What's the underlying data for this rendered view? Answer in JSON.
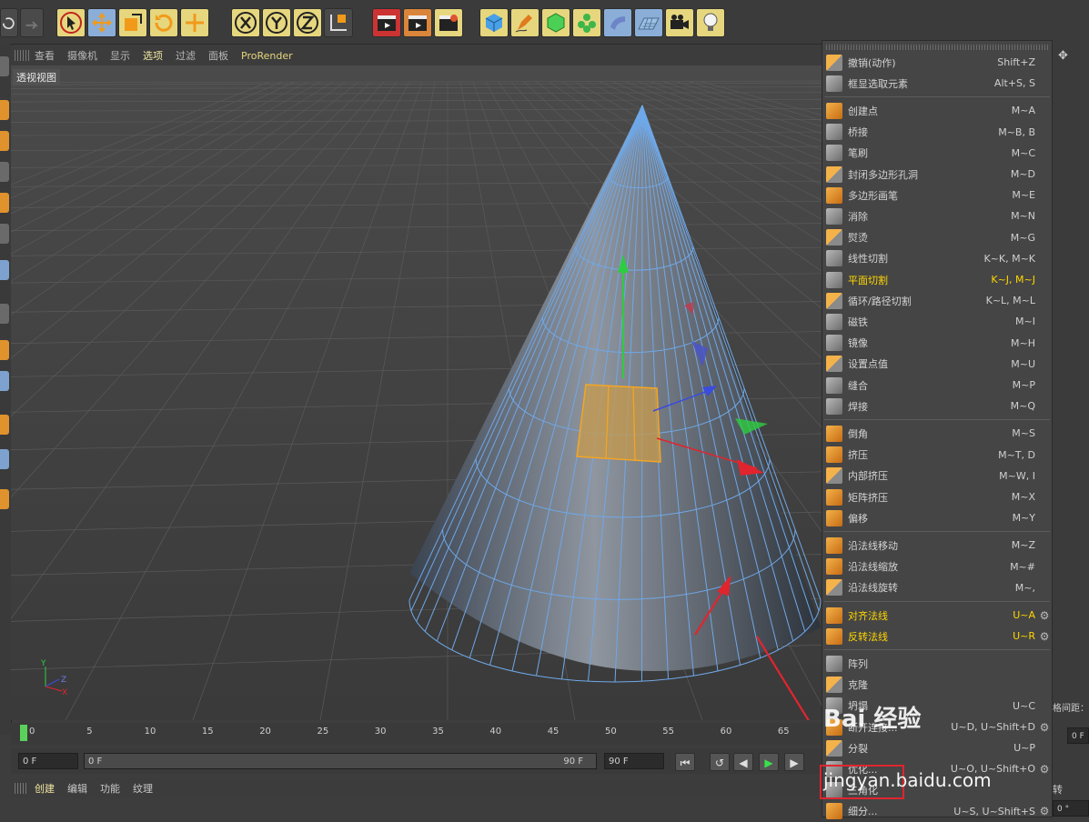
{
  "viewport": {
    "menu": [
      "查看",
      "摄像机",
      "显示",
      "选项",
      "过滤",
      "面板",
      "ProRender"
    ],
    "active_menu": "选项",
    "title": "透视视图",
    "axis_labels": {
      "y": "Y",
      "z": "Z",
      "x": "X"
    }
  },
  "context_menu": {
    "items": [
      {
        "label": "撤销(动作)",
        "shortcut": "Shift+Z",
        "icon": "undo-icon"
      },
      {
        "label": "框显选取元素",
        "shortcut": "Alt+S, S",
        "icon": "frame-selection-icon"
      },
      {
        "sep": true
      },
      {
        "label": "创建点",
        "shortcut": "M~A",
        "icon": "create-point-icon"
      },
      {
        "label": "桥接",
        "shortcut": "M~B, B",
        "icon": "bridge-icon"
      },
      {
        "label": "笔刷",
        "shortcut": "M~C",
        "icon": "brush-icon"
      },
      {
        "label": "封闭多边形孔洞",
        "shortcut": "M~D",
        "icon": "close-hole-icon"
      },
      {
        "label": "多边形画笔",
        "shortcut": "M~E",
        "icon": "polygon-pen-icon"
      },
      {
        "label": "消除",
        "shortcut": "M~N",
        "icon": "dissolve-icon"
      },
      {
        "label": "熨烫",
        "shortcut": "M~G",
        "icon": "iron-icon"
      },
      {
        "label": "线性切割",
        "shortcut": "K~K, M~K",
        "icon": "line-cut-icon"
      },
      {
        "label": "平面切割",
        "shortcut": "K~J, M~J",
        "icon": "plane-cut-icon",
        "highlight": true
      },
      {
        "label": "循环/路径切割",
        "shortcut": "K~L, M~L",
        "icon": "loop-cut-icon"
      },
      {
        "label": "磁铁",
        "shortcut": "M~I",
        "icon": "magnet-icon"
      },
      {
        "label": "镜像",
        "shortcut": "M~H",
        "icon": "mirror-icon"
      },
      {
        "label": "设置点值",
        "shortcut": "M~U",
        "icon": "set-point-value-icon"
      },
      {
        "label": "缝合",
        "shortcut": "M~P",
        "icon": "stitch-icon"
      },
      {
        "label": "焊接",
        "shortcut": "M~Q",
        "icon": "weld-icon"
      },
      {
        "sep": true
      },
      {
        "label": "倒角",
        "shortcut": "M~S",
        "icon": "bevel-icon"
      },
      {
        "label": "挤压",
        "shortcut": "M~T, D",
        "icon": "extrude-icon"
      },
      {
        "label": "内部挤压",
        "shortcut": "M~W, I",
        "icon": "extrude-inner-icon"
      },
      {
        "label": "矩阵挤压",
        "shortcut": "M~X",
        "icon": "matrix-extrude-icon"
      },
      {
        "label": "偏移",
        "shortcut": "M~Y",
        "icon": "offset-icon"
      },
      {
        "sep": true
      },
      {
        "label": "沿法线移动",
        "shortcut": "M~Z",
        "icon": "normal-move-icon"
      },
      {
        "label": "沿法线缩放",
        "shortcut": "M~#",
        "icon": "normal-scale-icon"
      },
      {
        "label": "沿法线旋转",
        "shortcut": "M~,",
        "icon": "normal-rotate-icon"
      },
      {
        "sep": true
      },
      {
        "label": "对齐法线",
        "shortcut": "U~A",
        "icon": "align-normals-icon",
        "highlight": true,
        "gear": true
      },
      {
        "label": "反转法线",
        "shortcut": "U~R",
        "icon": "reverse-normals-icon",
        "highlight": true,
        "gear": true
      },
      {
        "sep": true
      },
      {
        "label": "阵列",
        "shortcut": "",
        "icon": "array-icon"
      },
      {
        "label": "克隆",
        "shortcut": "",
        "icon": "clone-icon"
      },
      {
        "label": "坍塌",
        "shortcut": "U~C",
        "icon": "collapse-icon"
      },
      {
        "label": "断开连接...",
        "shortcut": "U~D, U~Shift+D",
        "icon": "disconnect-icon",
        "gear": true
      },
      {
        "label": "分裂",
        "shortcut": "U~P",
        "icon": "split-icon"
      },
      {
        "label": "优化...",
        "shortcut": "U~O, U~Shift+O",
        "icon": "optimize-icon",
        "gear": true
      },
      {
        "label": "三角化",
        "shortcut": "",
        "icon": "triangulate-icon"
      },
      {
        "label": "细分...",
        "shortcut": "U~S, U~Shift+S",
        "icon": "subdivide-icon",
        "gear": true
      }
    ]
  },
  "timeline": {
    "ticks": [
      "0",
      "5",
      "10",
      "15",
      "20",
      "25",
      "30",
      "35",
      "40",
      "45",
      "50",
      "55",
      "60",
      "65"
    ],
    "current_frame": "0 F",
    "range_start": "0 F",
    "range_end": "90 F",
    "max_frame": "90 F"
  },
  "bottom_menu": [
    "创建",
    "编辑",
    "功能",
    "纹理"
  ],
  "bottom_menu_active": "创建",
  "right_edge": {
    "grid_label": "格间距：",
    "field_1": "0 F",
    "field_2": "0 °",
    "rotate": "转"
  },
  "watermark": {
    "brand": "Bai 经验",
    "url": "jingyan.baidu.com"
  },
  "colors": {
    "accent_highlight": "#ffd700",
    "selection": "#f5a623",
    "wire": "#6fa8e8",
    "annotation": "#e0252f"
  }
}
